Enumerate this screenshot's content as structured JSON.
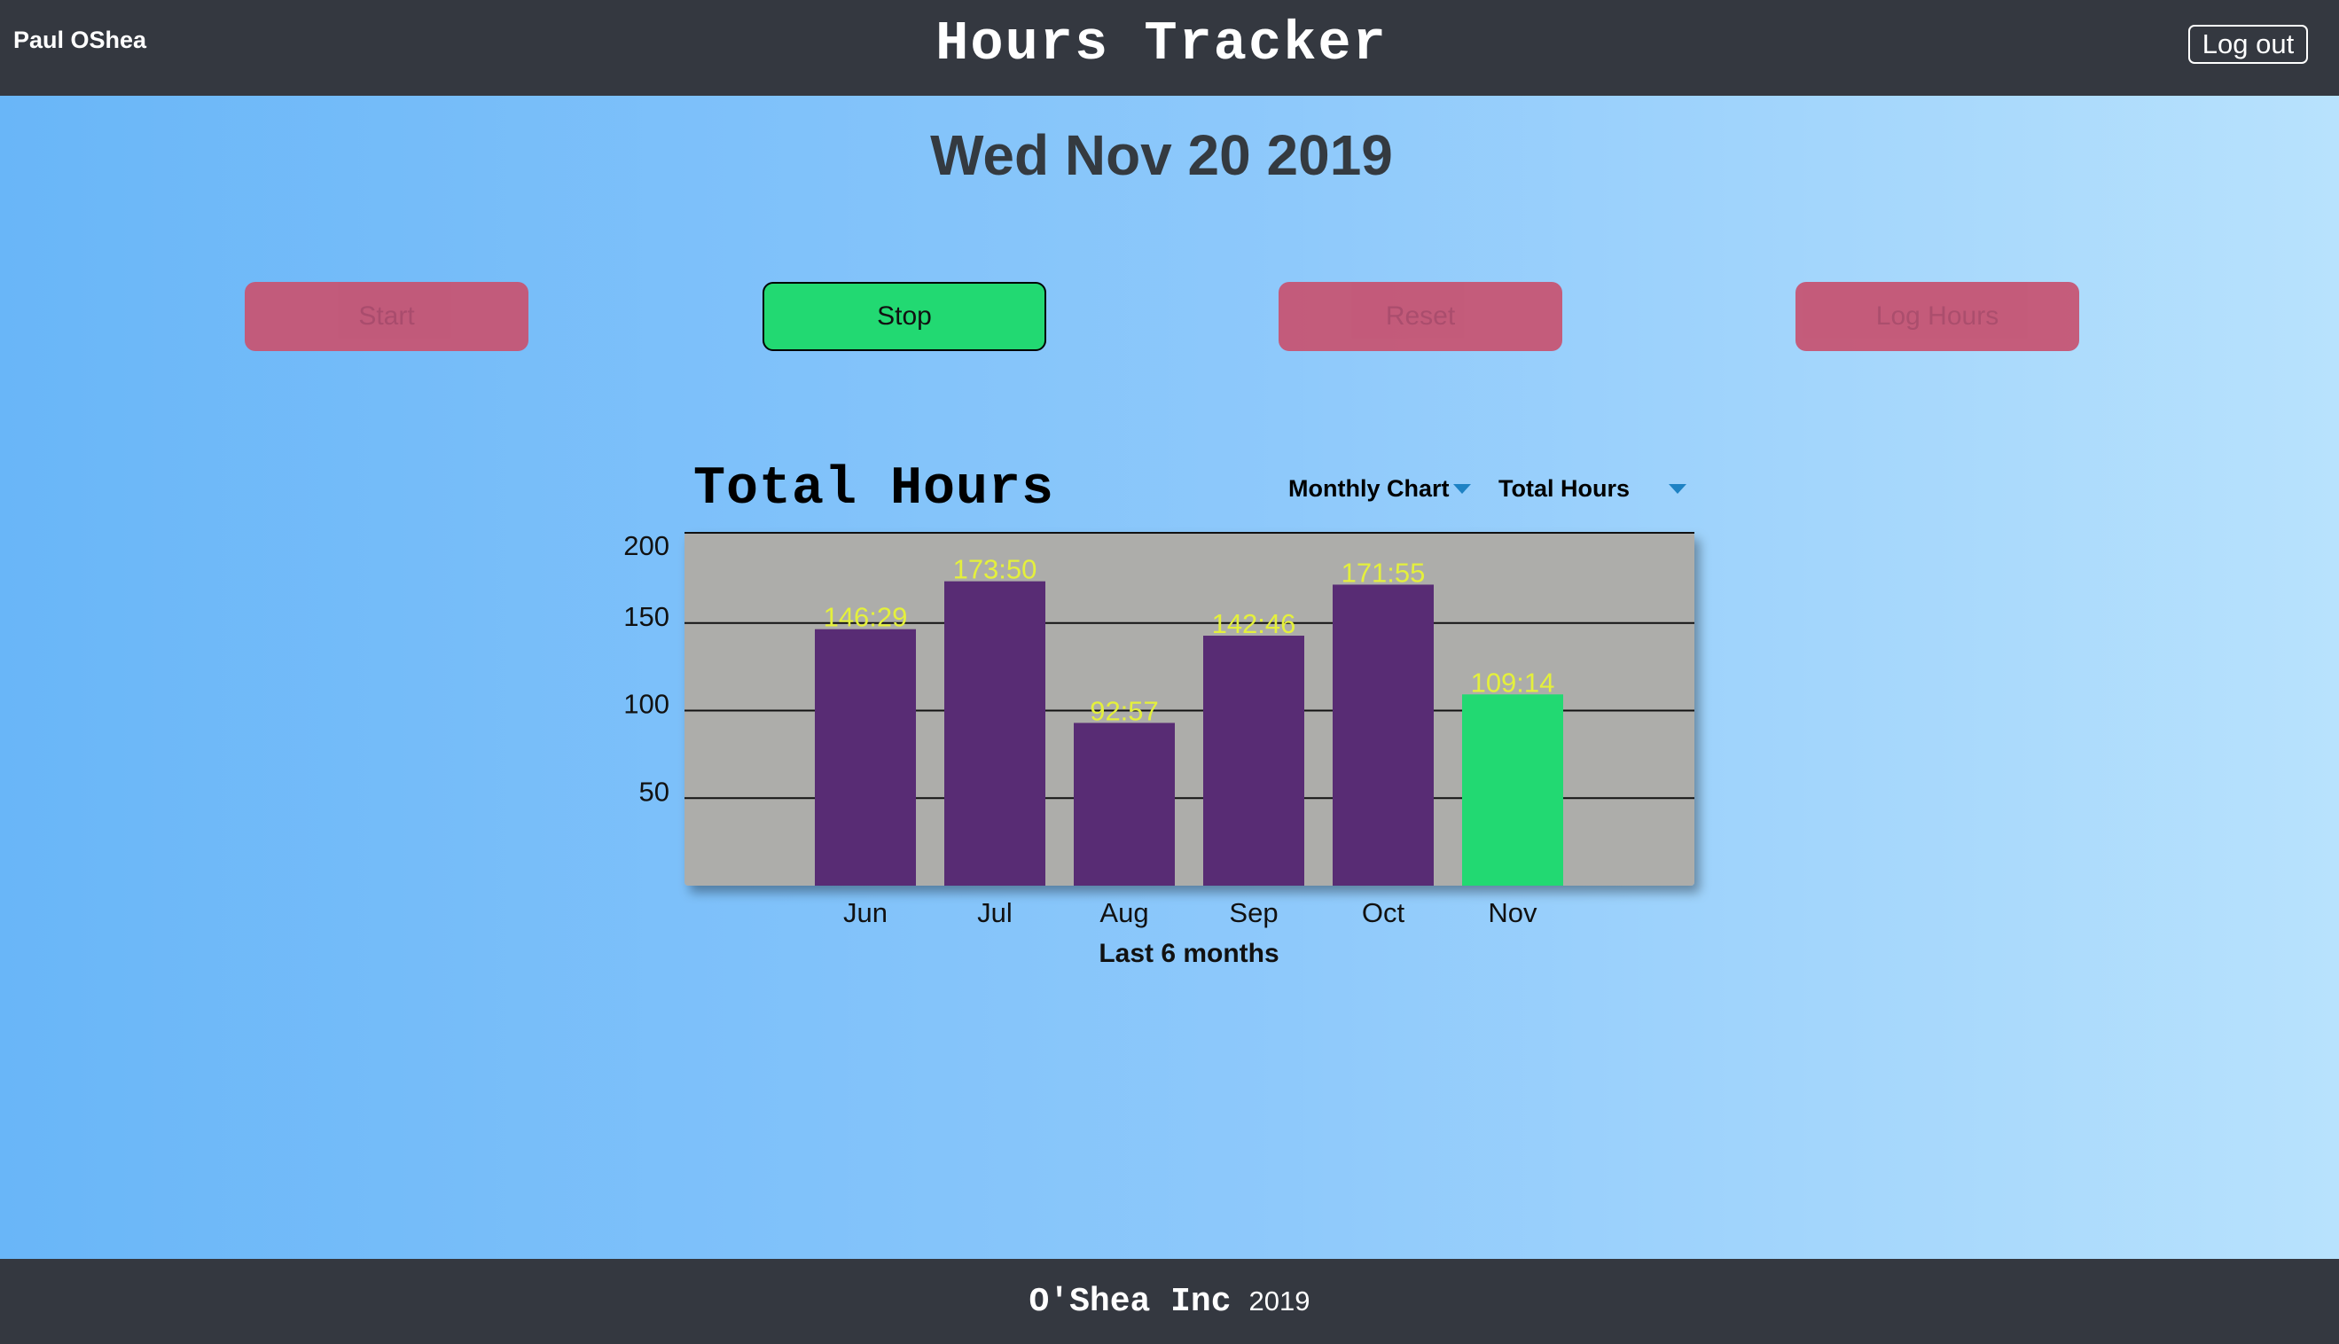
{
  "header": {
    "user_name": "Paul OShea",
    "title": "Hours Tracker",
    "logout_label": "Log out"
  },
  "date": "Wed Nov 20 2019",
  "controls": {
    "start_label": "Start",
    "stop_label": "Stop",
    "reset_label": "Reset",
    "log_hours_label": "Log Hours"
  },
  "chart_panel": {
    "title": "Total Hours",
    "chart_type_select": "Monthly Chart",
    "metric_select": "Total Hours"
  },
  "chart_data": {
    "type": "bar",
    "categories": [
      "Jun",
      "Jul",
      "Aug",
      "Sep",
      "Oct",
      "Nov"
    ],
    "values": [
      146.48,
      173.83,
      92.95,
      142.77,
      171.92,
      109.23
    ],
    "data_labels": [
      "146:29",
      "173:50",
      "92:57",
      "142:46",
      "171:55",
      "109:14"
    ],
    "yticks": [
      50,
      100,
      150,
      200
    ],
    "ylim": [
      0,
      200
    ],
    "xlabel": "Last 6 months",
    "ylabel": "",
    "grid": true,
    "colors": {
      "bar": "#582c74",
      "highlight": "#22d972",
      "label": "#e4f03c",
      "plot_bg": "#adadaa"
    },
    "highlight_index": 5
  },
  "footer": {
    "company": "O'Shea Inc",
    "year": "2019"
  }
}
